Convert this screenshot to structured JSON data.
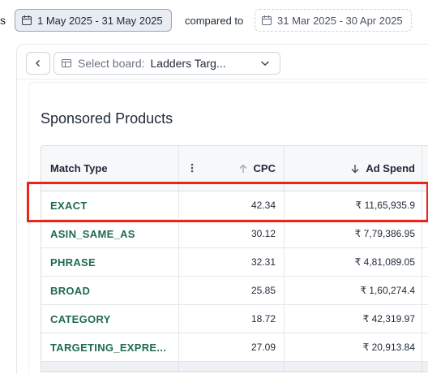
{
  "edge_glyph": "s",
  "date_range": {
    "primary": "1 May 2025 - 31 May 2025",
    "compared_label": "compared to",
    "comparison": "31 Mar 2025 - 30 Apr 2025"
  },
  "toolbar": {
    "select_label": "Select board:",
    "select_value": "Ladders Targ..."
  },
  "section_title": "Sponsored Products",
  "table": {
    "columns": [
      "Match Type",
      "CPC",
      "Ad Spend"
    ],
    "rows": [
      {
        "match_type": "EXACT",
        "cpc": "42.34",
        "ad_spend": "₹ 11,65,935.9"
      },
      {
        "match_type": "ASIN_SAME_AS",
        "cpc": "30.12",
        "ad_spend": "₹ 7,79,386.95"
      },
      {
        "match_type": "PHRASE",
        "cpc": "32.31",
        "ad_spend": "₹ 4,81,089.05"
      },
      {
        "match_type": "BROAD",
        "cpc": "25.85",
        "ad_spend": "₹ 1,60,274.4"
      },
      {
        "match_type": "CATEGORY",
        "cpc": "18.72",
        "ad_spend": "₹ 42,319.97"
      },
      {
        "match_type": "TARGETING_EXPRE...",
        "cpc": "27.09",
        "ad_spend": "₹ 20,913.84"
      }
    ]
  },
  "colors": {
    "highlight": "#e8261b",
    "match_type_text": "#1f6b4f"
  }
}
